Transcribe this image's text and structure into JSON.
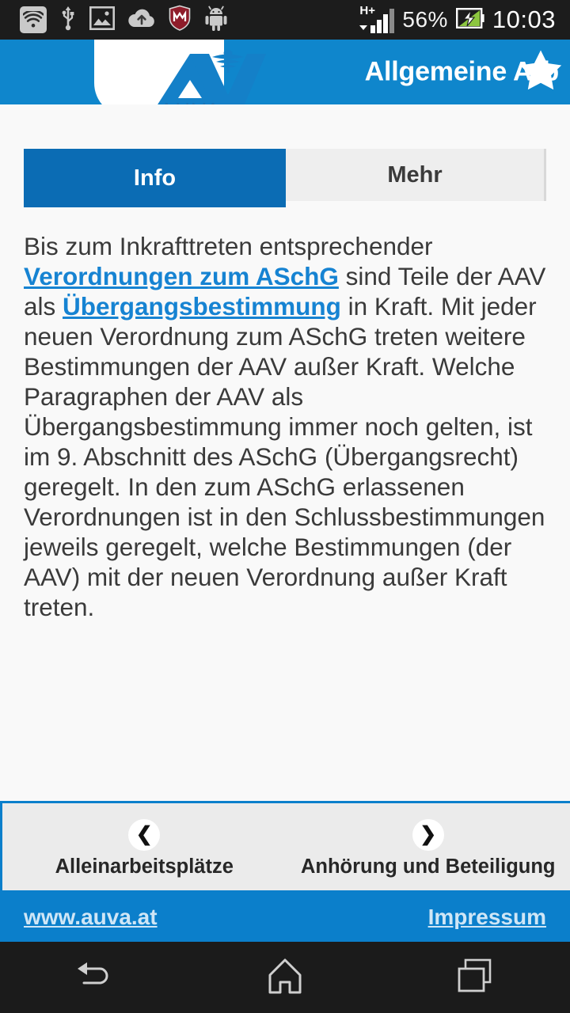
{
  "status_bar": {
    "left_icons": [
      "wifi-icon",
      "usb-icon",
      "image-icon",
      "cloud-upload-icon",
      "mcafee-shield-icon",
      "android-robot-icon"
    ],
    "network_type": "H+",
    "battery_percent": "56%",
    "battery_icon": "battery-charging-icon",
    "clock": "10:03"
  },
  "header": {
    "logo_name": "auva-logo",
    "logo_text": "AUVA",
    "title": "Allgemeine Arb",
    "favorite_icon": "star-icon",
    "bar_color": "#0f86cc"
  },
  "tabs": [
    {
      "label": "Info",
      "active": true
    },
    {
      "label": "Mehr",
      "active": false
    }
  ],
  "article": {
    "part1": "Bis zum Inkrafttreten entsprechender ",
    "link1": "Verordnungen zum ASchG",
    "part2": " sind Teile der AAV als ",
    "link2": "Übergangsbestimmung",
    "part3": " in Kraft. Mit jeder neuen Verordnung zum ASchG treten weitere Bestimmungen der AAV außer Kraft. Welche Paragraphen der AAV als Übergangsbestimmung immer noch gelten, ist im 9. Abschnitt des ASchG (Übergangsrecht) geregelt. In den zum ASchG erlassenen Verordnungen ist in den Schlussbestimmungen jeweils geregelt, welche Bestimmungen (der AAV) mit der neuen Verordnung außer Kraft treten."
  },
  "pager": {
    "prev": {
      "icon": "chevron-left-icon",
      "glyph": "❮",
      "label": "Alleinarbeitsplätze"
    },
    "next": {
      "icon": "chevron-right-icon",
      "glyph": "❯",
      "label": "Anhörung und Beteiligung"
    }
  },
  "footer": {
    "website": "www.auva.at",
    "imprint": "Impressum",
    "bar_color": "#0b7fcb"
  },
  "navbar": {
    "back": "back-icon",
    "home": "home-icon",
    "recents": "recents-icon"
  }
}
